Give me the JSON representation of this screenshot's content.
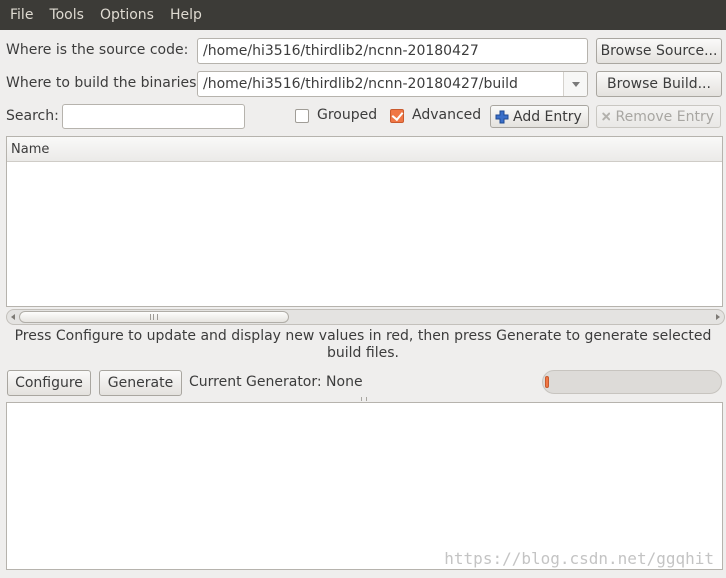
{
  "menu": {
    "file": "File",
    "tools": "Tools",
    "options": "Options",
    "help": "Help"
  },
  "source": {
    "label": "Where is the source code:",
    "value": "/home/hi3516/thirdlib2/ncnn-20180427",
    "browse_label": "Browse Source..."
  },
  "build": {
    "label": "Where to build the binaries:",
    "value": "/home/hi3516/thirdlib2/ncnn-20180427/build",
    "browse_label": "Browse Build..."
  },
  "search": {
    "label": "Search:",
    "value": ""
  },
  "options": {
    "grouped_label": "Grouped",
    "grouped_checked": false,
    "advanced_label": "Advanced",
    "advanced_checked": true
  },
  "entries": {
    "add_label": "Add Entry",
    "remove_label": "Remove Entry"
  },
  "table": {
    "column_name": "Name",
    "rows": []
  },
  "info_text": "Press Configure to update and display new values in red, then press Generate to generate selected build files.",
  "actions": {
    "configure_label": "Configure",
    "generate_label": "Generate",
    "generator_text": "Current Generator: None"
  },
  "progress": {
    "fraction": 0.02
  },
  "output_log": "",
  "watermark": "https://blog.csdn.net/ggqhit",
  "colors": {
    "menubar": "#3c3b37",
    "accent": "#f07746",
    "window_bg": "#efeeed"
  }
}
